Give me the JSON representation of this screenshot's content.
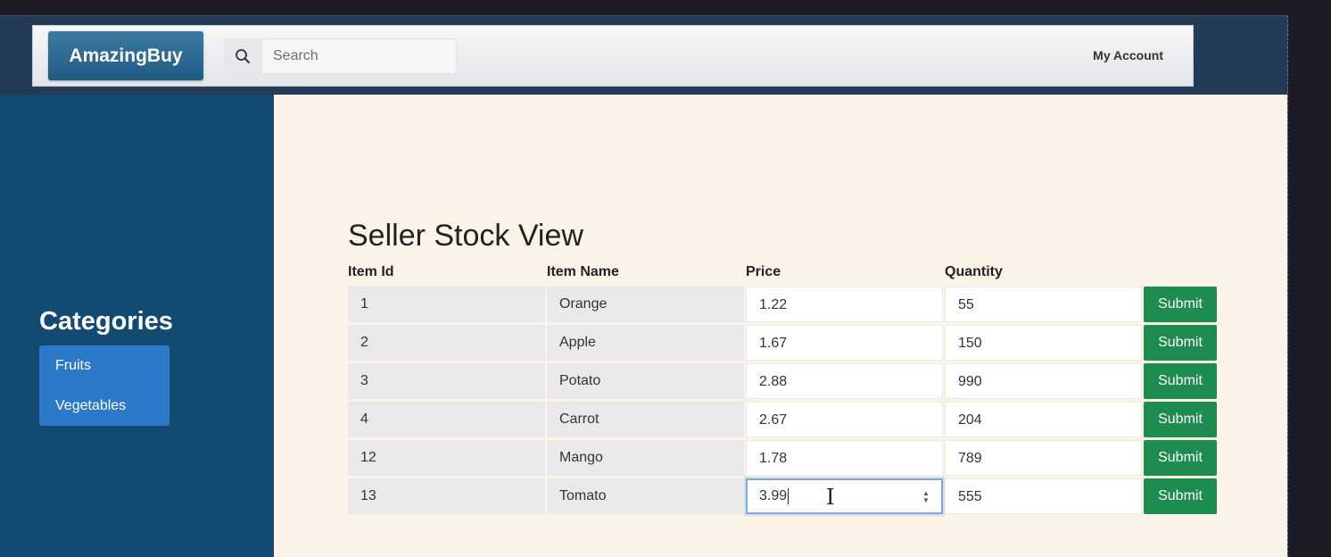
{
  "header": {
    "brand": "AmazingBuy",
    "search": {
      "placeholder": "Search",
      "value": ""
    },
    "account_label": "My Account"
  },
  "sidebar": {
    "title": "Categories",
    "items": [
      {
        "label": "Fruits"
      },
      {
        "label": "Vegetables"
      }
    ]
  },
  "main": {
    "title": "Seller Stock View",
    "columns": [
      "Item Id",
      "Item Name",
      "Price",
      "Quantity"
    ],
    "submit_label": "Submit",
    "rows": [
      {
        "id": "1",
        "name": "Orange",
        "price": "1.22",
        "quantity": "55"
      },
      {
        "id": "2",
        "name": "Apple",
        "price": "1.67",
        "quantity": "150"
      },
      {
        "id": "3",
        "name": "Potato",
        "price": "2.88",
        "quantity": "990"
      },
      {
        "id": "4",
        "name": "Carrot",
        "price": "2.67",
        "quantity": "204"
      },
      {
        "id": "12",
        "name": "Mango",
        "price": "1.78",
        "quantity": "789"
      },
      {
        "id": "13",
        "name": "Tomato",
        "price": "3.99",
        "quantity": "555"
      }
    ],
    "focused_row": 5
  },
  "colors": {
    "brand": "#1f5a84",
    "sidebar": "#124a72",
    "category_list": "#2b79c8",
    "submit": "#1e8b4f",
    "main_bg": "#fbf3e8"
  }
}
